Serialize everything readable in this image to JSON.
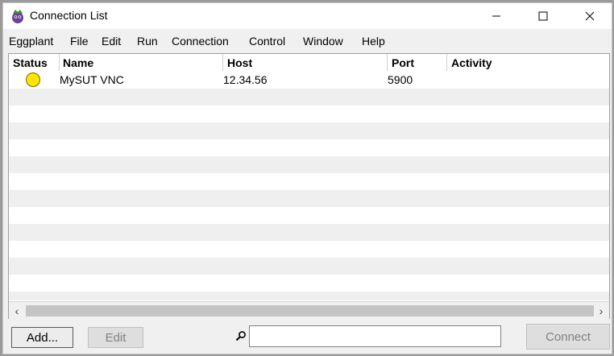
{
  "window": {
    "title": "Connection List",
    "icon": "eggplant-app-icon"
  },
  "menu": {
    "items": [
      "Eggplant",
      "File",
      "Edit",
      "Run",
      "Connection",
      "Control",
      "Window",
      "Help"
    ]
  },
  "table": {
    "columns": [
      "Status",
      "Name",
      "Host",
      "Port",
      "Activity"
    ],
    "rows": [
      {
        "status": "yellow",
        "name": "MySUT VNC",
        "host": "12.34.56",
        "port": "5900",
        "activity": ""
      }
    ]
  },
  "buttons": {
    "add": "Add...",
    "edit": "Edit",
    "connect": "Connect"
  },
  "search": {
    "value": "",
    "placeholder": ""
  },
  "colors": {
    "status_yellow": "#ffe500",
    "row_alt": "#efefef"
  }
}
